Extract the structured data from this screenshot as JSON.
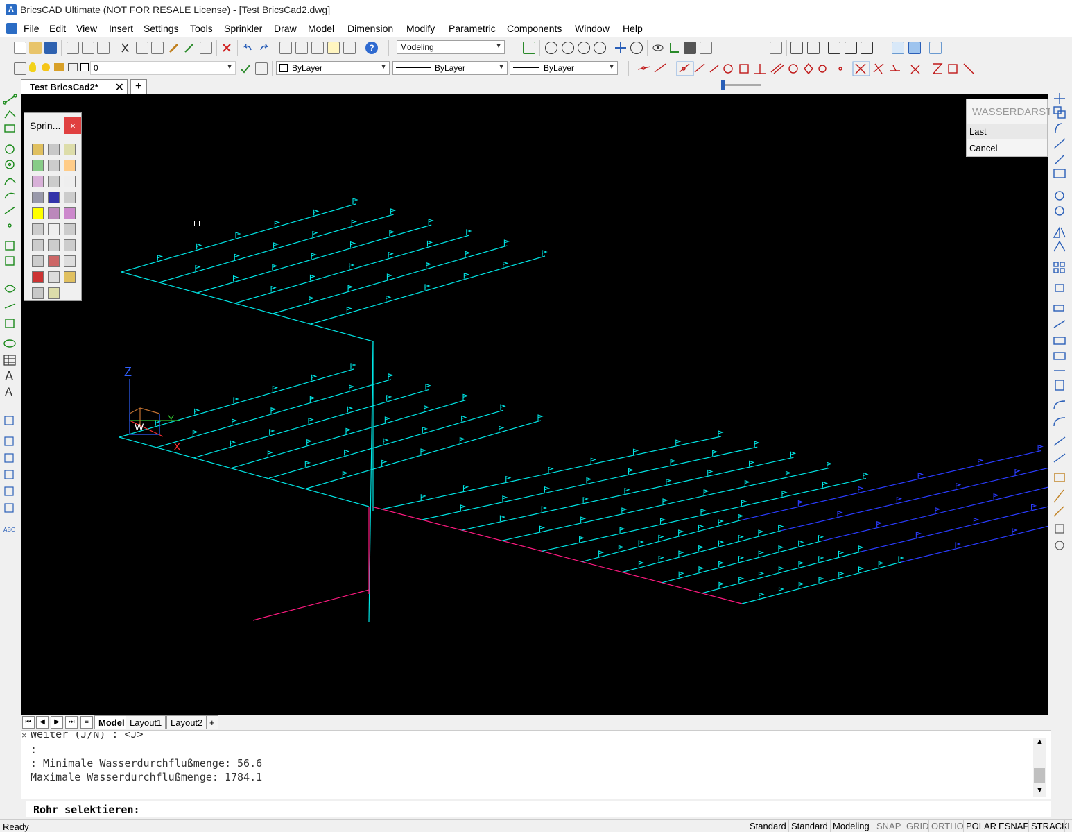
{
  "window": {
    "title": "BricsCAD Ultimate (NOT FOR RESALE License) - [Test BricsCad2.dwg]",
    "app_icon": "bricscad-logo-icon"
  },
  "menu": [
    "File",
    "Edit",
    "View",
    "Insert",
    "Settings",
    "Tools",
    "Sprinkler",
    "Draw",
    "Model",
    "Dimension",
    "Modify",
    "Parametric",
    "Components",
    "Window",
    "Help"
  ],
  "toolbar": {
    "workspace": "Modeling",
    "layer": "0",
    "color": "ByLayer",
    "linetype": "ByLayer",
    "lineweight": "ByLayer"
  },
  "document_tab": "Test BricsCad2*",
  "sprinkler_panel": {
    "title": "Sprin...",
    "close": "×"
  },
  "context_menu": {
    "header": "WASSERDARST",
    "items": [
      "Last",
      "Cancel"
    ]
  },
  "ucs": {
    "z": "Z",
    "y": "Y",
    "x": "X",
    "w": "W"
  },
  "layout_tabs": [
    "Model",
    "Layout1",
    "Layout2",
    "+"
  ],
  "command_history": [
    "Weiter (J/N) : <J>",
    ":",
    ": Minimale Wasserdurchflußmenge: 56.6",
    "Maximale Wasserdurchflußmenge: 1784.1"
  ],
  "command_prompt": "Rohr selektieren:",
  "status": {
    "ready": "Ready",
    "items": [
      {
        "label": "Standard",
        "on": true
      },
      {
        "label": "Standard",
        "on": true
      },
      {
        "label": "Modeling",
        "on": true
      },
      {
        "label": "SNAP",
        "on": false
      },
      {
        "label": "GRID",
        "on": false
      },
      {
        "label": "ORTHO",
        "on": false
      },
      {
        "label": "POLAR",
        "on": true
      },
      {
        "label": "ESNAP",
        "on": true
      },
      {
        "label": "STRACK",
        "on": true
      },
      {
        "label": "L",
        "on": false
      }
    ]
  },
  "colors": {
    "pipe_cyan": "#00e5e5",
    "pipe_magenta": "#ff1a80",
    "pipe_blue": "#2a3cff",
    "pipe_purple": "#a020c0"
  }
}
